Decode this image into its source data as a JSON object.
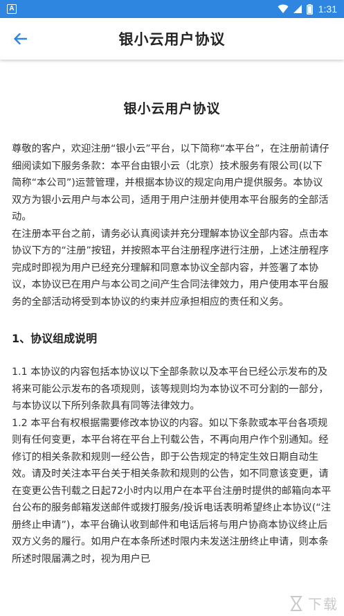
{
  "status_bar": {
    "app_badge": "A",
    "time": "1:31",
    "icons": [
      "wifi-icon",
      "signal-icon",
      "battery-icon"
    ]
  },
  "app_bar": {
    "title": "银小云用户协议",
    "back_icon": "arrow-left-icon"
  },
  "document": {
    "title": "银小云用户协议",
    "intro_paragraphs": [
      "尊敬的客户，欢迎注册“银小云”平台，以下简称“本平台”，在注册前请仔细阅读如下服务条款：本平台由银小云（北京）技术服务有限公司(以下简称“本公司”)运营管理，并根据本协议的规定向用户提供服务。本协议双方为银小云用户与本公司，适用于用户注册并使用本平台服务的全部活动。",
      "在注册本平台之前，请务必认真阅读并充分理解本协议全部内容。点击本协议下方的“注册”按钮，并按照本平台注册程序进行注册，上述注册程序完成时即视为用户已经充分理解和同意本协议全部内容，并签署了本协议，本协议已在用户与本公司之间产生合同法律效力，用户使用本平台服务的全部活动将受到本协议的约束并应承担相应的责任和义务。"
    ],
    "section_1": {
      "heading": "1、协议组成说明",
      "paragraphs": [
        "1.1 本协议的内容包括本协议以下全部条款以及本平台已经公示发布的及将来可能公示发布的各项规则，该等规则均为本协议不可分割的一部分，与本协议以下所列条款具有同等法律效力。",
        "1.2 本平台有权根据需要修改本协议的内容。如以下条款或本平台各项规则有任何变更，本平台将在平台上刊载公告，不再向用户作个别通知。经修订的相关条款和规则一经公告，即于公告规定的特定生效日期自动生效。请及时关注本平台关于相关条款和规则的公告，如不同意该变更，请在变更公告刊载之日起72小时内以用户在本平台注册时提供的邮箱向本平台公布的服务邮箱发送邮件或拨打服务/投诉电话表明希望终止本协议(“注册终止申请”)，本平台确认收到邮件和电话后将与用户协商本协议终止后双方义务的履行。如用户在本条所述时限内未发送注册终止申请，则本条所述时限届满之时，视为用户已"
      ]
    }
  },
  "watermark": {
    "text": "下载"
  }
}
